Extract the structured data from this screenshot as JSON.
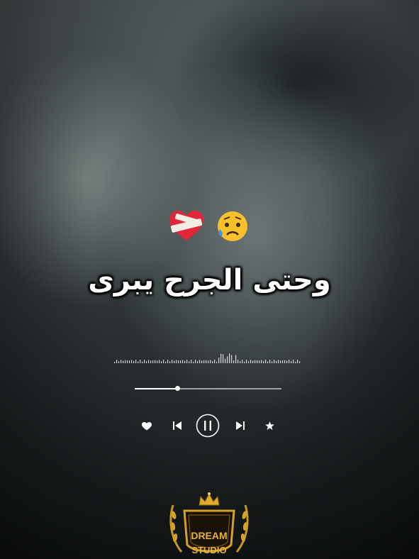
{
  "overlay": {
    "emojis": [
      "sad-but-relieved-face",
      "mending-heart"
    ],
    "lyric": "وحتى الجرح يبرى"
  },
  "player": {
    "progress_fraction": 0.29,
    "is_playing": true,
    "icons": [
      "heart-icon",
      "previous-icon",
      "pause-icon",
      "next-icon",
      "star-icon"
    ]
  },
  "watermark": {
    "line1": "DREAM",
    "line2": "STUDIO"
  },
  "colors": {
    "text": "#ffffff",
    "logo_gold": "#d4a22a"
  }
}
